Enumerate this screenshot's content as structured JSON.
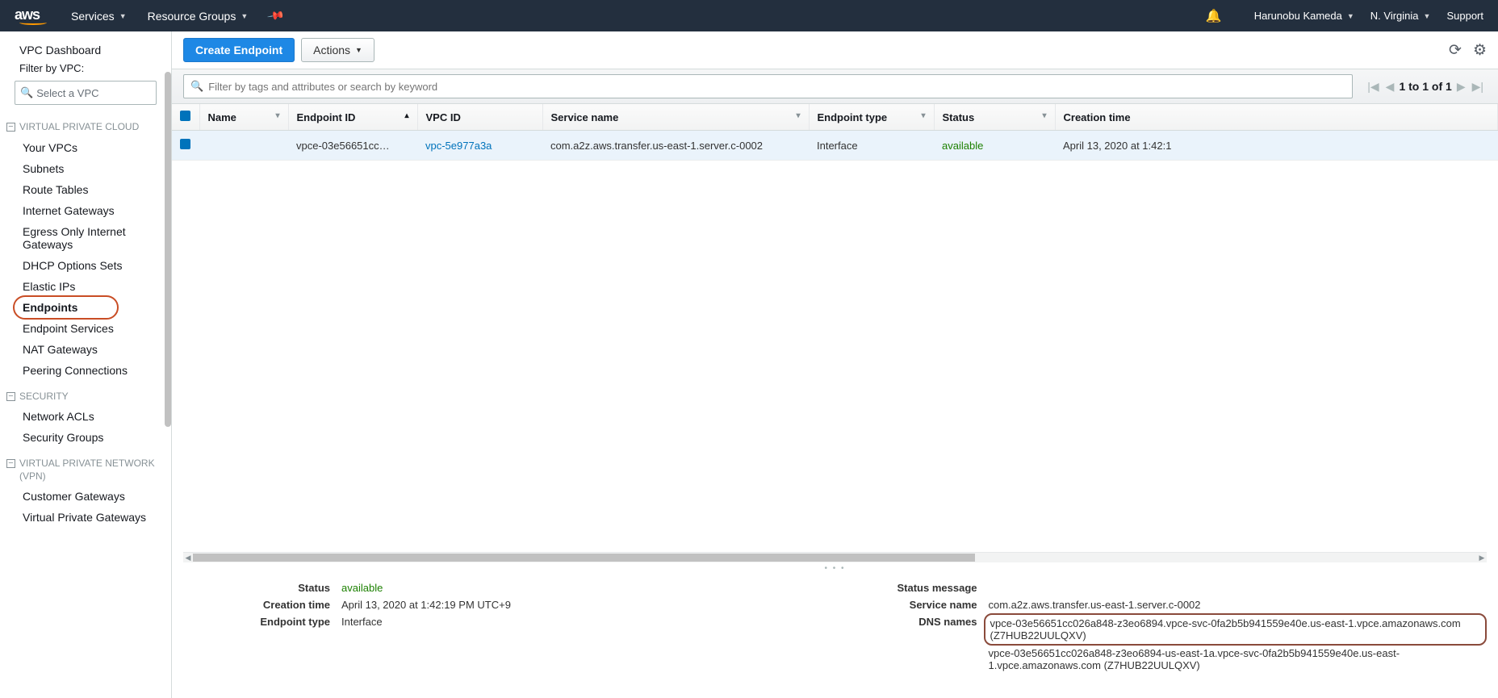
{
  "topnav": {
    "services": "Services",
    "resource_groups": "Resource Groups",
    "user": "Harunobu Kameda",
    "region": "N. Virginia",
    "support": "Support"
  },
  "sidebar": {
    "dashboard": "VPC Dashboard",
    "filter_label": "Filter by VPC:",
    "filter_placeholder": "Select a VPC",
    "grp_vpc": "VIRTUAL PRIVATE CLOUD",
    "your_vpcs": "Your VPCs",
    "subnets": "Subnets",
    "route_tables": "Route Tables",
    "igw": "Internet Gateways",
    "eigw": "Egress Only Internet Gateways",
    "dhcp": "DHCP Options Sets",
    "eip": "Elastic IPs",
    "endpoints": "Endpoints",
    "endpoint_svc": "Endpoint Services",
    "nat": "NAT Gateways",
    "peering": "Peering Connections",
    "grp_sec": "SECURITY",
    "nacls": "Network ACLs",
    "sg": "Security Groups",
    "grp_vpn": "VIRTUAL PRIVATE NETWORK (VPN)",
    "cgw": "Customer Gateways",
    "vpg": "Virtual Private Gateways"
  },
  "toolbar": {
    "create": "Create Endpoint",
    "actions": "Actions"
  },
  "search": {
    "placeholder": "Filter by tags and attributes or search by keyword",
    "page": "1 to 1 of 1"
  },
  "cols": {
    "name": "Name",
    "endpoint_id": "Endpoint ID",
    "vpc_id": "VPC ID",
    "service_name": "Service name",
    "endpoint_type": "Endpoint type",
    "status": "Status",
    "creation": "Creation time"
  },
  "row": {
    "endpoint_id": "vpce-03e56651cc…",
    "vpc_id": "vpc-5e977a3a",
    "service_name": "com.a2z.aws.transfer.us-east-1.server.c-0002",
    "endpoint_type": "Interface",
    "status": "available",
    "creation": "April 13, 2020 at 1:42:1"
  },
  "details": {
    "status_l": "Status",
    "status_v": "available",
    "creation_l": "Creation time",
    "creation_v": "April 13, 2020 at 1:42:19 PM UTC+9",
    "etype_l": "Endpoint type",
    "etype_v": "Interface",
    "smsg_l": "Status message",
    "sname_l": "Service name",
    "sname_v": "com.a2z.aws.transfer.us-east-1.server.c-0002",
    "dns_l": "DNS names",
    "dns1": "vpce-03e56651cc026a848-z3eo6894.vpce-svc-0fa2b5b941559e40e.us-east-1.vpce.amazonaws.com (Z7HUB22UULQXV)",
    "dns2": "vpce-03e56651cc026a848-z3eo6894-us-east-1a.vpce-svc-0fa2b5b941559e40e.us-east-1.vpce.amazonaws.com (Z7HUB22UULQXV)"
  }
}
